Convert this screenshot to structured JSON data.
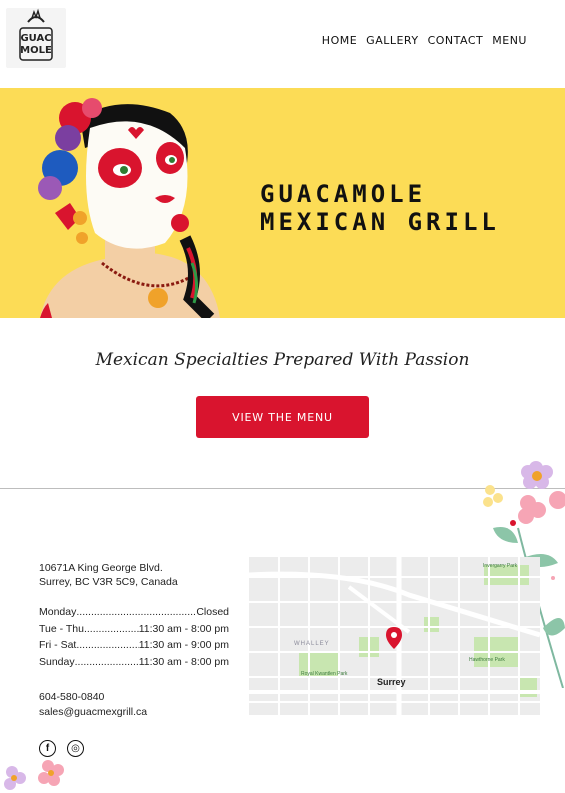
{
  "header": {
    "logo_text": "Guacamole",
    "nav": [
      "HOME",
      "GALLERY",
      "CONTACT",
      "MENU"
    ]
  },
  "hero": {
    "title_line1": "GUACAMOLE",
    "title_line2": "MEXICAN GRILL"
  },
  "tagline": "Mexican Specialties Prepared With Passion",
  "cta_label": "VIEW THE MENU",
  "address": {
    "line1": "10671A King George Blvd.",
    "line2": "Surrey, BC V3R 5C9, Canada"
  },
  "hours": [
    {
      "day": "Monday",
      "time": "Closed"
    },
    {
      "day": "Tue - Thu",
      "time": "11:30 am - 8:00 pm"
    },
    {
      "day": "Fri - Sat",
      "time": "11:30 am - 9:00 pm"
    },
    {
      "day": "Sunday",
      "time": "11:30 am - 8:00 pm"
    }
  ],
  "contact": {
    "phone": "604-580-0840",
    "email": "sales@guacmexgrill.ca"
  },
  "map": {
    "city_label": "Surrey",
    "district_label": "WHALLEY",
    "parks": [
      "Royal Kwantlen Park",
      "Hawthorne Park",
      "Invergarry Park"
    ]
  },
  "social": {
    "facebook": "f",
    "instagram": "◎"
  },
  "colors": {
    "hero_bg": "#fcdc56",
    "accent": "#d9142e"
  }
}
